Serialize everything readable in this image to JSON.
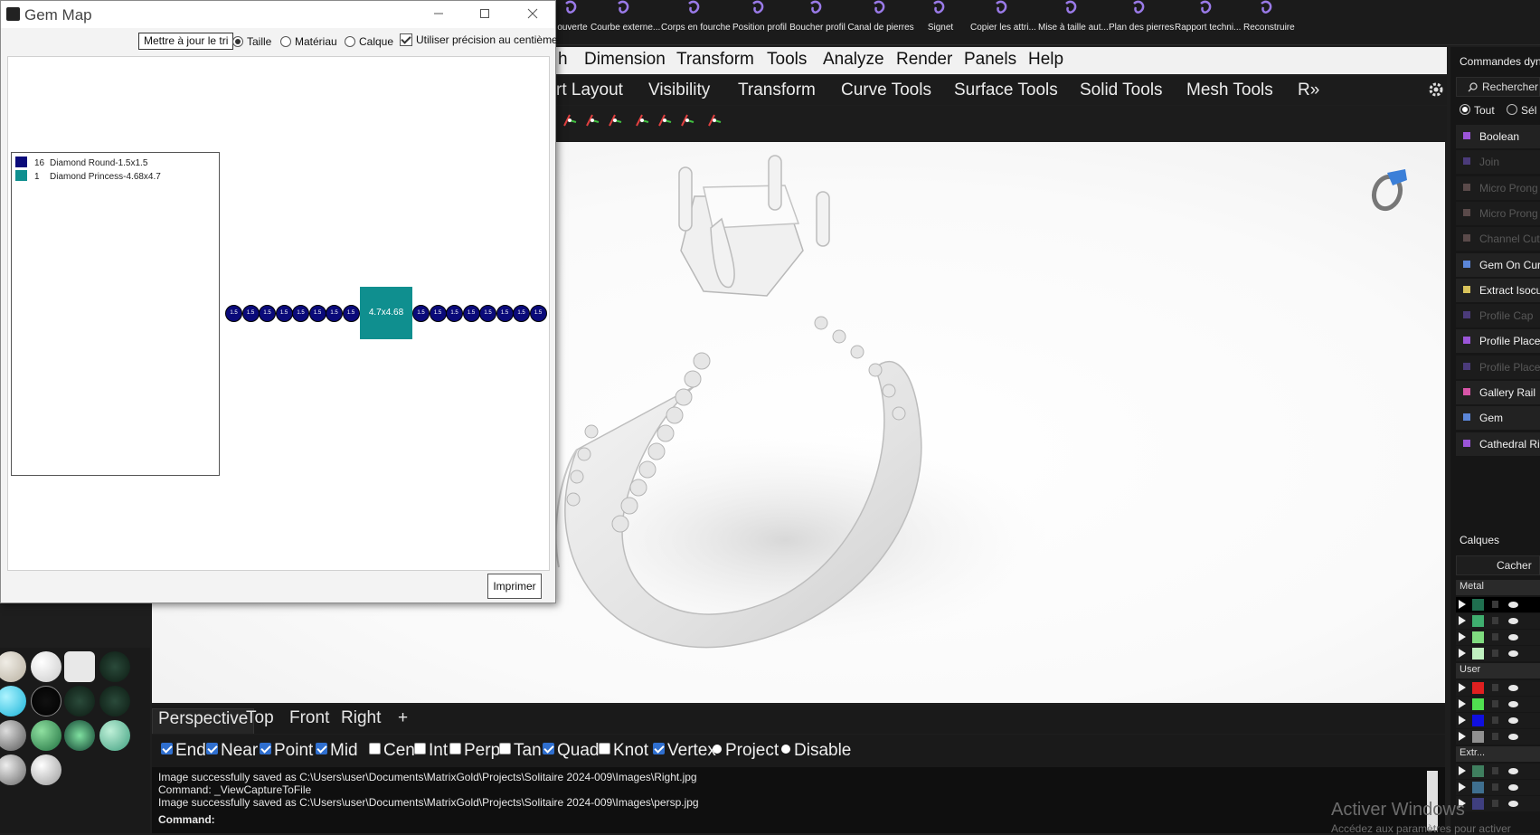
{
  "top_toolbar": {
    "buttons": [
      {
        "label": "ouverte",
        "icon": "open-curve-icon"
      },
      {
        "label": "Courbe externe...",
        "icon": "external-curve-icon"
      },
      {
        "label": "Corps en fourche",
        "icon": "fork-body-icon"
      },
      {
        "label": "Position profil",
        "icon": "profile-position-icon"
      },
      {
        "label": "Boucher profil",
        "icon": "cap-profile-icon"
      },
      {
        "label": "Canal de pierres",
        "icon": "stone-channel-icon"
      },
      {
        "label": "Signet",
        "icon": "bookmark-icon"
      },
      {
        "label": "Copier les attri...",
        "icon": "copy-attributes-icon"
      },
      {
        "label": "Mise à taille aut...",
        "icon": "auto-size-icon"
      },
      {
        "label": "Plan des pierres",
        "icon": "gem-map-icon"
      },
      {
        "label": "Rapport techni...",
        "icon": "tech-report-icon"
      },
      {
        "label": "Reconstruire",
        "icon": "rebuild-icon"
      }
    ]
  },
  "menu": {
    "items": [
      "h",
      "Dimension",
      "Transform",
      "Tools",
      "Analyze",
      "Render",
      "Panels",
      "Help"
    ]
  },
  "tabs": {
    "items": [
      "rt Layout",
      "Visibility",
      "Transform",
      "Curve Tools",
      "Surface Tools",
      "Solid Tools",
      "Mesh Tools",
      "R»"
    ]
  },
  "gem_map": {
    "title": "Gem Map",
    "update_button": "Mettre à jour le tri",
    "opt_size": "Taille",
    "opt_material": "Matériau",
    "opt_layer": "Calque",
    "opt_precision": "Utiliser précision au centième",
    "print_button": "Imprimer",
    "legend": [
      {
        "count": "16",
        "name": "Diamond Round-1.5x1.5",
        "color": "#0a0a7a"
      },
      {
        "count": "1",
        "name": "Diamond Princess-4.68x4.7",
        "color": "#0f8f8f"
      }
    ],
    "round_label": "1.5",
    "princess_label": "4.7x4.68"
  },
  "viewport": {
    "tabs": [
      "Perspective",
      "Top",
      "Front",
      "Right",
      "+"
    ]
  },
  "osnaps": [
    {
      "label": "End",
      "checked": true
    },
    {
      "label": "Near",
      "checked": true
    },
    {
      "label": "Point",
      "checked": true
    },
    {
      "label": "Mid",
      "checked": true
    },
    {
      "label": "Cen",
      "checked": false
    },
    {
      "label": "Int",
      "checked": false
    },
    {
      "label": "Perp",
      "checked": false
    },
    {
      "label": "Tan",
      "checked": false
    },
    {
      "label": "Quad",
      "checked": true
    },
    {
      "label": "Knot",
      "checked": false
    },
    {
      "label": "Vertex",
      "checked": true
    },
    {
      "label": "Project",
      "checked": false
    },
    {
      "label": "Disable",
      "checked": false
    }
  ],
  "command": {
    "history": [
      "Image successfully saved as C:\\Users\\user\\Documents\\MatrixGold\\Projects\\Solitaire 2024-009\\Images\\Right.jpg",
      "Command: _ViewCaptureToFile",
      "Image successfully saved as C:\\Users\\user\\Documents\\MatrixGold\\Projects\\Solitaire 2024-009\\Images\\persp.jpg"
    ],
    "prompt": "Command:"
  },
  "right_panel": {
    "title": "Commandes dyn",
    "search_placeholder": "Rechercher",
    "filter_all": "Tout",
    "filter_sel": "Sél",
    "commands": [
      {
        "label": "Boolean",
        "color": "#9b55d8",
        "enabled": true
      },
      {
        "label": "Join",
        "color": "#4b3b7a",
        "enabled": false
      },
      {
        "label": "Micro Prong",
        "color": "#5a4a4a",
        "enabled": false
      },
      {
        "label": "Micro Prong",
        "color": "#5a4a4a",
        "enabled": false
      },
      {
        "label": "Channel Cut",
        "color": "#5a4a4a",
        "enabled": false
      },
      {
        "label": "Gem On Cur",
        "color": "#5b86d8",
        "enabled": true
      },
      {
        "label": "Extract Isocu",
        "color": "#d8c35b",
        "enabled": true
      },
      {
        "label": "Profile Cap",
        "color": "#4b3b7a",
        "enabled": false
      },
      {
        "label": "Profile Place",
        "color": "#9b55d8",
        "enabled": true
      },
      {
        "label": "Profile Place",
        "color": "#4b3b7a",
        "enabled": false
      },
      {
        "label": "Gallery Rail",
        "color": "#d855a8",
        "enabled": true
      },
      {
        "label": "Gem",
        "color": "#5b86d8",
        "enabled": true
      },
      {
        "label": "Cathedral Ri",
        "color": "#9b55d8",
        "enabled": true
      }
    ],
    "layers_title": "Calques",
    "layers_hide": "Cacher",
    "layer_groups": [
      {
        "name": "Metal",
        "colors": [
          "#1f6f4f",
          "#3fae6f",
          "#7fdc7f",
          "#bff0bf"
        ]
      },
      {
        "name": "User",
        "colors": [
          "#e02020",
          "#50e050",
          "#1010e0",
          "#909090"
        ]
      },
      {
        "name": "Extr...",
        "colors": [
          "#3f7f5f",
          "#3f6f8f",
          "#3f3f7f"
        ]
      }
    ]
  },
  "watermark": {
    "title": "Activer Windows",
    "subtitle": "Accédez aux paramètres pour activer"
  }
}
